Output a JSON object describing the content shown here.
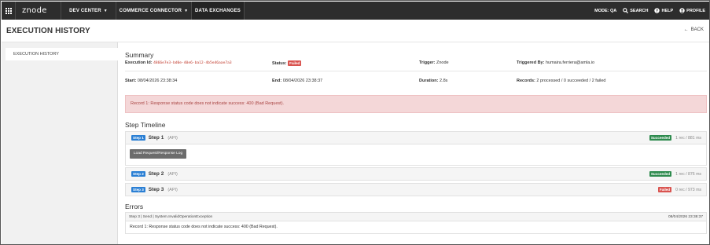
{
  "nav": {
    "logo": "znode",
    "items": [
      {
        "label": "DEV CENTER",
        "caret": "▼"
      },
      {
        "label": "COMMERCE CONNECTOR",
        "caret": "▼"
      },
      {
        "label": "DATA EXCHANGES"
      }
    ],
    "mode": "MODE: QA",
    "search": "SEARCH",
    "help": "HELP",
    "profile": "PROFILE"
  },
  "header": {
    "title": "EXECUTION HISTORY",
    "back": "BACK",
    "back_arrow": "←"
  },
  "sidebar": {
    "items": [
      {
        "label": "EXECUTION HISTORY"
      }
    ]
  },
  "summary": {
    "title": "Summary",
    "execution_id_label": "Execution Id:",
    "execution_id": "4866e7e3-bd0e-40e6-ba12-4b5e46aae7a3",
    "status_label": "Status:",
    "status": "Failed",
    "trigger_label": "Trigger:",
    "trigger": "Znode",
    "triggered_by_label": "Triggered By:",
    "triggered_by": "humaira.ferriera@amla.io",
    "start_label": "Start:",
    "start": "08/04/2026 23:38:34",
    "end_label": "End:",
    "end": "08/04/2026 23:38:37",
    "duration_label": "Duration:",
    "duration": "2.8s",
    "records_label": "Records:",
    "records": "2 processed / 0 succeeded / 2 failed",
    "alert": "Record 1: Response status code does not indicate success: 400 (Bad Request)."
  },
  "timeline": {
    "title": "Step Timeline",
    "steps": [
      {
        "badge": "Step 1",
        "name": "Step 1",
        "kind": "(API)",
        "status": "Succeeded",
        "status_color": "#2e8b4e",
        "stat": "1 rec / 881 ms",
        "button": "Load Request/Response Log"
      },
      {
        "badge": "Step 2",
        "name": "Step 2",
        "kind": "(API)",
        "status": "Succeeded",
        "status_color": "#2e8b4e",
        "stat": "1 rec / 876 ms"
      },
      {
        "badge": "Step 3",
        "name": "Step 3",
        "kind": "(API)",
        "status": "Failed",
        "status_color": "#d9534f",
        "stat": "0 rec / 973 ms"
      }
    ]
  },
  "errors": {
    "title": "Errors",
    "items": [
      {
        "source": "Step 3 | Send | System.InvalidOperationException",
        "timestamp": "08/04/2026 23:38:37",
        "message": "Record 1: Response status code does not indicate success: 400 (Bad Request)."
      }
    ]
  }
}
